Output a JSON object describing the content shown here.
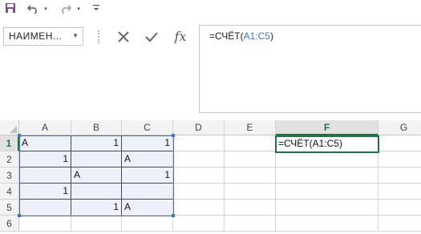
{
  "qat": {
    "save_icon": "save-icon",
    "undo_icon": "undo-icon",
    "redo_icon": "redo-icon",
    "customize_icon": "customize-qat-icon"
  },
  "namebox": {
    "value": "НАИМЕН..."
  },
  "formula_bar": {
    "prefix": "=СЧЁТ(",
    "ref": "A1:C5",
    "suffix": ")",
    "cancel_icon": "✕",
    "enter_icon": "✓",
    "fx_label": "fx"
  },
  "columns": [
    "A",
    "B",
    "C",
    "D",
    "E",
    "F",
    "G"
  ],
  "selected_column": "F",
  "rows": [
    "1",
    "2",
    "3",
    "4",
    "5",
    "6"
  ],
  "selected_row": "1",
  "cells": {
    "A1": "A",
    "B1": "1",
    "C1": "1",
    "A2": "1",
    "B2": "",
    "C2": "A",
    "A3": "",
    "B3": "A",
    "C3": "1",
    "A4": "1",
    "B4": "",
    "C4": "",
    "A5": "",
    "B5": "1",
    "C5": "A"
  },
  "active_cell": {
    "prefix": "=СЧЁТ(",
    "ref": "A1:C5",
    "suffix": ")"
  },
  "colors": {
    "accent_green": "#217346",
    "range_blue": "#4472c4"
  }
}
